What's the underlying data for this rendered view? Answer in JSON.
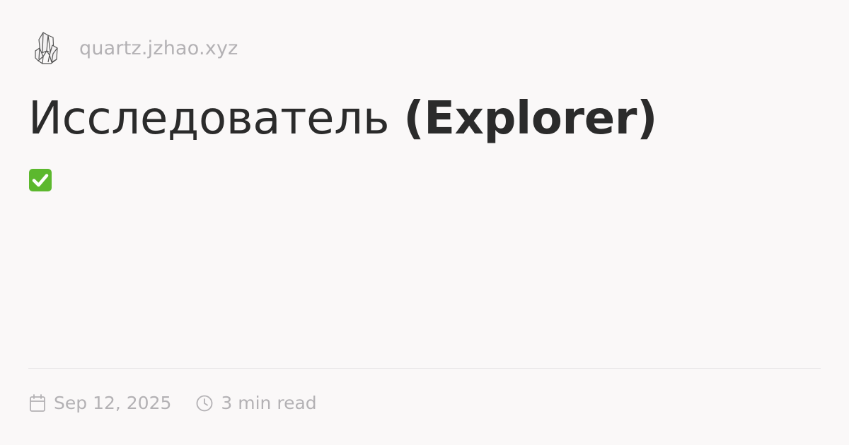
{
  "site": {
    "logo_icon": "crystal-logo-icon",
    "name": "quartz.jzhao.xyz"
  },
  "page": {
    "title_main": "Исследователь",
    "title_paren": "(Explorer)",
    "status_icon": "check-mark-icon",
    "status_color": "#5cb82e"
  },
  "meta": {
    "date_icon": "calendar-icon",
    "date": "Sep 12, 2025",
    "read_icon": "clock-icon",
    "reading_time": "3 min read"
  },
  "colors": {
    "background": "#faf8f8",
    "text": "#2b2b2b",
    "muted": "#b3b1b4",
    "divider": "#e9e6e8"
  }
}
